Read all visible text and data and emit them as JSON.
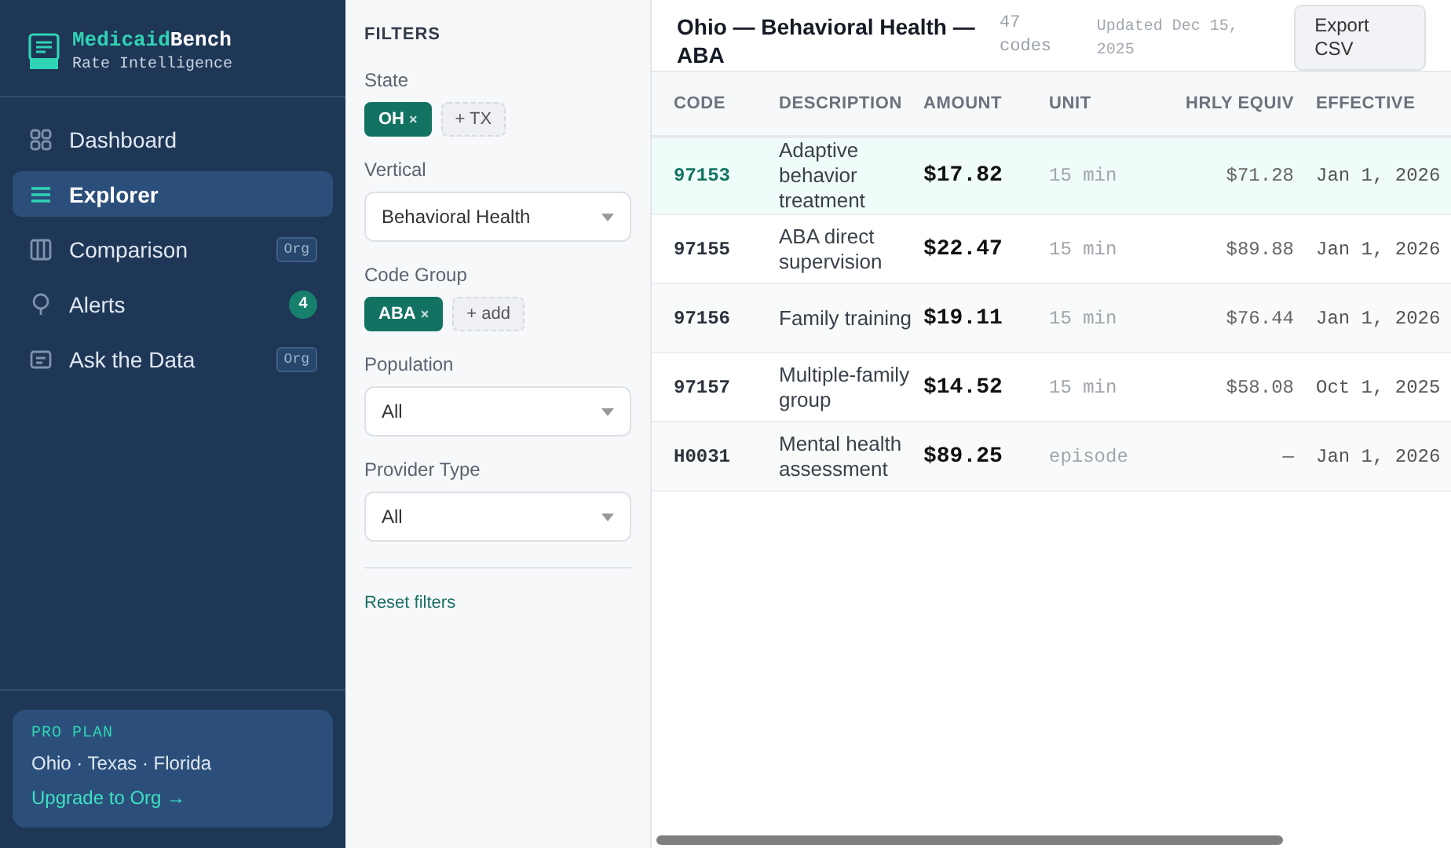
{
  "brand": {
    "name_accent": "Medicaid",
    "name_rest": "Bench",
    "tagline": "Rate Intelligence"
  },
  "nav": [
    {
      "label": "Dashboard",
      "selected": false
    },
    {
      "label": "Explorer",
      "selected": true
    },
    {
      "label": "Comparison",
      "selected": false,
      "badge": {
        "kind": "tag",
        "text": "Org"
      }
    },
    {
      "label": "Alerts",
      "selected": false,
      "badge": {
        "kind": "count",
        "text": "4"
      }
    },
    {
      "label": "Ask the Data",
      "selected": false,
      "badge": {
        "kind": "tag",
        "text": "Org"
      }
    }
  ],
  "plan": {
    "title": "PRO PLAN",
    "states": "Ohio · Texas · Florida",
    "link": "Upgrade to Org →"
  },
  "filters": {
    "title": "FILTERS",
    "groups": [
      {
        "kind": "chips",
        "label": "State",
        "chips": [
          {
            "label": "OH",
            "remove": "×",
            "selected": true
          },
          {
            "label": "+ TX",
            "selected": false
          }
        ]
      },
      {
        "kind": "select",
        "label": "Vertical",
        "value": "Behavioral Health"
      },
      {
        "kind": "chips",
        "label": "Code Group",
        "chips": [
          {
            "label": "ABA",
            "remove": "×",
            "selected": true
          },
          {
            "label": "+ add",
            "selected": false
          }
        ]
      },
      {
        "kind": "select",
        "label": "Population",
        "value": "All"
      },
      {
        "kind": "select",
        "label": "Provider Type",
        "value": "All"
      }
    ],
    "reset": "Reset filters"
  },
  "header": {
    "title": "Ohio — Behavioral Health — ABA",
    "count": "47 codes",
    "updated": "Updated Dec 15, 2025",
    "export": "Export CSV"
  },
  "table": {
    "columns": [
      "CODE",
      "DESCRIPTION",
      "AMOUNT",
      "UNIT",
      "HRLY EQUIV",
      "EFFECTIVE"
    ],
    "rows": [
      {
        "code": "97153",
        "description": "Adaptive behavior treatment",
        "amount": "$17.82",
        "unit": "15 min",
        "hourly": "$71.28",
        "effective": "Jan 1, 2026",
        "selected": true
      },
      {
        "code": "97155",
        "description": "ABA direct supervision",
        "amount": "$22.47",
        "unit": "15 min",
        "hourly": "$89.88",
        "effective": "Jan 1, 2026",
        "selected": false
      },
      {
        "code": "97156",
        "description": "Family training",
        "amount": "$19.11",
        "unit": "15 min",
        "hourly": "$76.44",
        "effective": "Jan 1, 2026",
        "selected": false
      },
      {
        "code": "97157",
        "description": "Multiple-family group",
        "amount": "$14.52",
        "unit": "15 min",
        "hourly": "$58.08",
        "effective": "Oct 1, 2025",
        "selected": false
      },
      {
        "code": "H0031",
        "description": "Mental health assessment",
        "amount": "$89.25",
        "unit": "episode",
        "hourly": "—",
        "effective": "Jan 1, 2026",
        "selected": false
      }
    ]
  }
}
